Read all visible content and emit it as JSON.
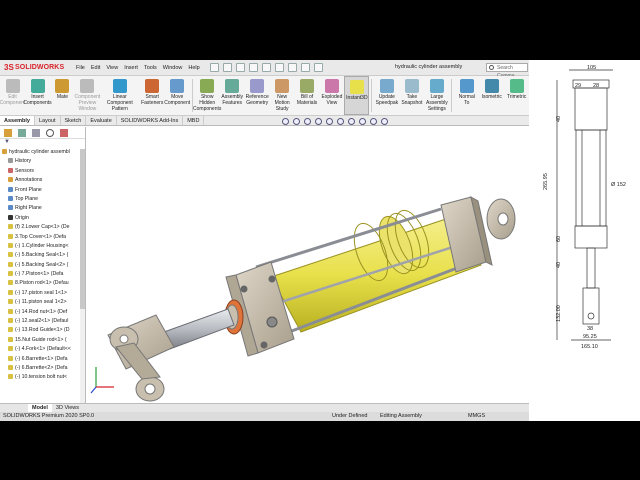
{
  "app": {
    "brand": "SOLIDWORKS",
    "document_title": "hydraulic cylinder assembly",
    "search_placeholder": "Search Comma"
  },
  "menu": [
    "File",
    "Edit",
    "View",
    "Insert",
    "Tools",
    "Window",
    "Help"
  ],
  "commands": [
    {
      "label": "Edit Component",
      "state": "disabled"
    },
    {
      "label": "Insert Components",
      "state": "normal"
    },
    {
      "label": "Mate",
      "state": "normal"
    },
    {
      "label": "Component Preview Window",
      "state": "disabled"
    },
    {
      "label": "Linear Component Pattern",
      "state": "normal"
    },
    {
      "label": "Smart Fasteners",
      "state": "normal"
    },
    {
      "label": "Move Component",
      "state": "normal"
    },
    {
      "label": "Show Hidden Components",
      "state": "normal"
    },
    {
      "label": "Assembly Features",
      "state": "normal"
    },
    {
      "label": "Reference Geometry",
      "state": "normal"
    },
    {
      "label": "New Motion Study",
      "state": "normal"
    },
    {
      "label": "Bill of Materials",
      "state": "normal"
    },
    {
      "label": "Exploded View",
      "state": "normal"
    },
    {
      "label": "Instant3D",
      "state": "active"
    },
    {
      "label": "Update Speedpak",
      "state": "normal"
    },
    {
      "label": "Take Snapshot",
      "state": "normal"
    },
    {
      "label": "Large Assembly Settings",
      "state": "normal"
    },
    {
      "label": "Normal To",
      "state": "normal"
    },
    {
      "label": "Isometric",
      "state": "normal"
    },
    {
      "label": "Trimetric",
      "state": "normal"
    }
  ],
  "tabs": [
    "Assembly",
    "Layout",
    "Sketch",
    "Evaluate",
    "SOLIDWORKS Add-Ins",
    "MBD"
  ],
  "active_tab": "Assembly",
  "feature_tree": [
    "hydraulic cylinder assembl",
    "History",
    "Sensors",
    "Annotations",
    "Front Plane",
    "Top Plane",
    "Right Plane",
    "Origin",
    "(f) 2.Lower Cap<1> (De",
    "3.Top Cover<1> (Defa",
    "(-) 1.Cylinder Housing<",
    "(-) 5.Backing Seal<1> (",
    "(-) 5.Backing Seal<2> (",
    "(-) 7.Piston<1> (Defa",
    "8.Piston rod<1> (Defau",
    "(-) 17.piston seal 1<1>",
    "(-) 11.piston seal 1<2>",
    "(-) 14.Rod nut<1> (Def",
    "(-) 12.seal2<1> (Defaul",
    "(-) 13.Rod Guide<1> (D",
    "15.Nut Guide rod<1> (",
    "(-) 4.Fork<1> (Default<<",
    "(-) 6.Barrette<1> (Defa",
    "(-) 6.Barrette<2> (Defa",
    "(-) 10.tension bolt nut<"
  ],
  "model_tabs": [
    "Model",
    "3D Views"
  ],
  "status": {
    "product": "SOLIDWORKS Premium 2020 SP0.0",
    "definition": "Under Defined",
    "mode": "Editing Assembly",
    "units": "MMGS"
  },
  "drawing": {
    "dims": [
      "105",
      "29",
      "28",
      "40",
      "265.95",
      "Ø 152",
      "60",
      "40",
      "132.00",
      "38",
      "95.25",
      "165.10"
    ]
  },
  "colors": {
    "brand_red": "#d8232a",
    "housing_yellow": "#e8e04a",
    "cap_tan": "#c9bfae",
    "rod_steel": "#b8bcc2",
    "seal_orange": "#e0733a"
  }
}
